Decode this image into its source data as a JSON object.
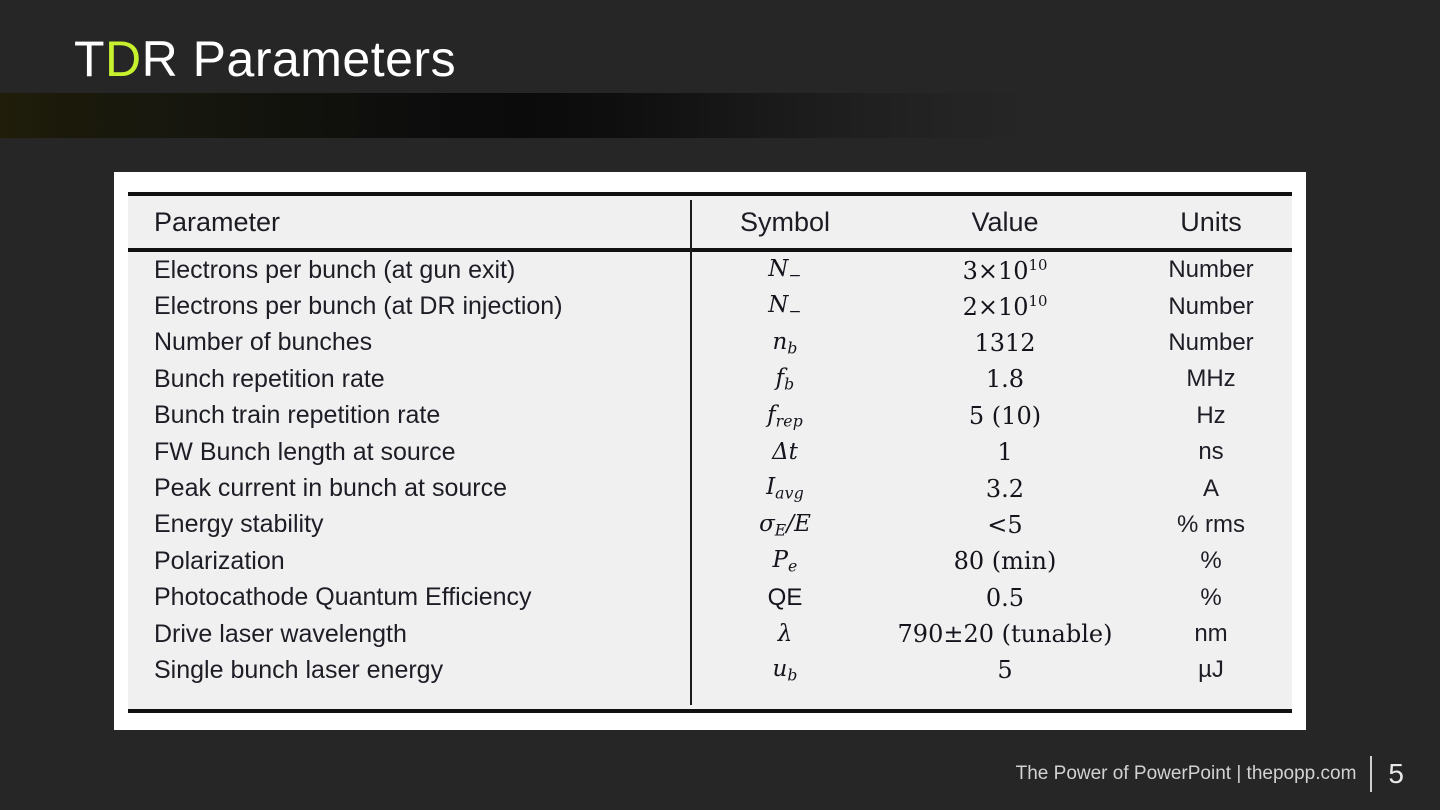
{
  "slide": {
    "title_prefix": "T",
    "title_accent": "D",
    "title_suffix": "R Parameters",
    "title_full": "TDR Parameters",
    "accent_color": "#c7f02e",
    "background_color": "#262626"
  },
  "table": {
    "headers": {
      "parameter": "Parameter",
      "symbol": "Symbol",
      "value": "Value",
      "units": "Units"
    },
    "rows": [
      {
        "parameter": "Electrons per bunch (at gun exit)",
        "symbol_base": "N",
        "symbol_sub": "−",
        "symbol_upright": false,
        "value_mantissa": "3×10",
        "value_exp": "10",
        "value_rest": "",
        "units": "Number"
      },
      {
        "parameter": "Electrons per bunch (at DR injection)",
        "symbol_base": "N",
        "symbol_sub": "−",
        "symbol_upright": false,
        "value_mantissa": "2×10",
        "value_exp": "10",
        "value_rest": "",
        "units": "Number"
      },
      {
        "parameter": "Number of bunches",
        "symbol_base": "n",
        "symbol_sub": "b",
        "symbol_upright": false,
        "value_mantissa": "1312",
        "value_exp": "",
        "value_rest": "",
        "units": "Number"
      },
      {
        "parameter": "Bunch repetition rate",
        "symbol_base": "f",
        "symbol_sub": "b",
        "symbol_upright": false,
        "value_mantissa": "1.8",
        "value_exp": "",
        "value_rest": "",
        "units": "MHz"
      },
      {
        "parameter": "Bunch train repetition rate",
        "symbol_base": "f",
        "symbol_sub": "rep",
        "symbol_upright": false,
        "value_mantissa": "5 (10)",
        "value_exp": "",
        "value_rest": "",
        "units": "Hz"
      },
      {
        "parameter": "FW Bunch length at source",
        "symbol_base": "Δt",
        "symbol_sub": "",
        "symbol_upright": false,
        "value_mantissa": "1",
        "value_exp": "",
        "value_rest": "",
        "units": "ns"
      },
      {
        "parameter": "Peak current in bunch at source",
        "symbol_base": "I",
        "symbol_sub": "avg",
        "symbol_upright": false,
        "value_mantissa": "3.2",
        "value_exp": "",
        "value_rest": "",
        "units": "A"
      },
      {
        "parameter": "Energy stability",
        "symbol_base": "σ",
        "symbol_sub": "E",
        "symbol_upright": false,
        "symbol_tail": "/E",
        "value_mantissa": "<5",
        "value_exp": "",
        "value_rest": "",
        "units": "% rms"
      },
      {
        "parameter": "Polarization",
        "symbol_base": "P",
        "symbol_sub": "e",
        "symbol_upright": false,
        "value_mantissa": "80 (min)",
        "value_exp": "",
        "value_rest": "",
        "units": "%"
      },
      {
        "parameter": "Photocathode Quantum Efficiency",
        "symbol_base": "QE",
        "symbol_sub": "",
        "symbol_upright": true,
        "value_mantissa": "0.5",
        "value_exp": "",
        "value_rest": "",
        "units": "%"
      },
      {
        "parameter": "Drive laser wavelength",
        "symbol_base": "λ",
        "symbol_sub": "",
        "symbol_upright": false,
        "value_mantissa": "790±20 (tunable)",
        "value_exp": "",
        "value_rest": "",
        "units": "nm"
      },
      {
        "parameter": "Single bunch laser energy",
        "symbol_base": "u",
        "symbol_sub": "b",
        "symbol_upright": false,
        "value_mantissa": "5",
        "value_exp": "",
        "value_rest": "",
        "units": "µJ"
      }
    ]
  },
  "footer": {
    "credit": "The Power of PowerPoint | thepopp.com",
    "slide_number": "5"
  }
}
